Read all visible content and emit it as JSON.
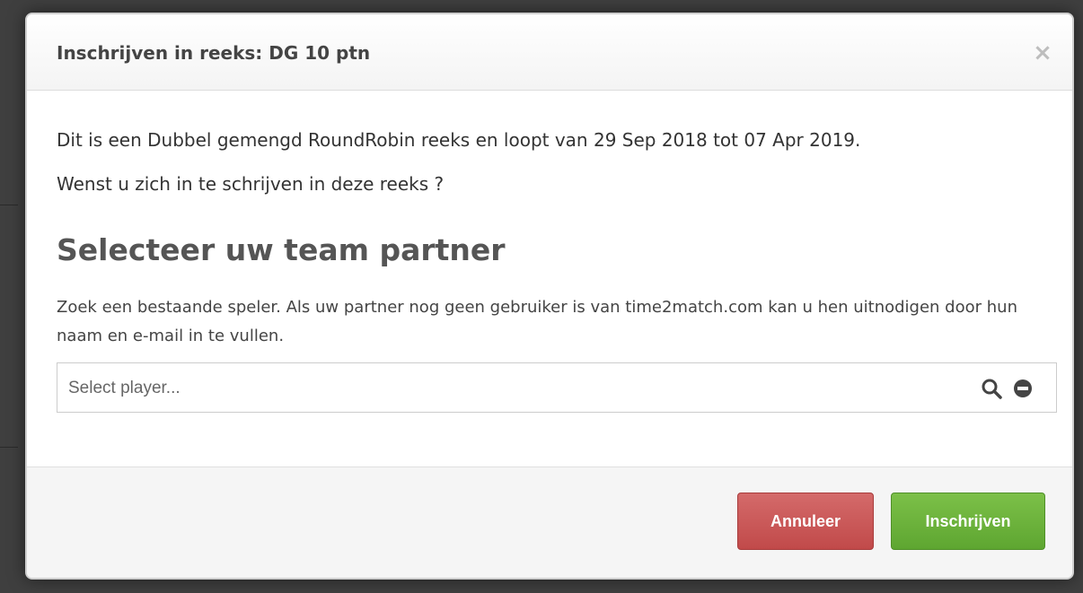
{
  "modal": {
    "title": "Inschrijven in reeks: DG 10 ptn",
    "close_symbol": "×",
    "close_icon": "close-icon",
    "description": "Dit is een Dubbel gemengd RoundRobin reeks en loopt van 29 Sep 2018 tot 07 Apr 2019.",
    "question": "Wenst u zich in te schrijven in deze reeks ?",
    "section_title": "Selecteer uw team partner",
    "help_text": "Zoek een bestaande speler. Als uw partner nog geen gebruiker is van time2match.com kan u hen uitnodigen door hun naam en e-mail in te vullen.",
    "player_select": {
      "placeholder": "Select player...",
      "value": "",
      "icons": [
        "search-icon",
        "minus-circle-icon"
      ]
    },
    "footer": {
      "cancel_label": "Annuleer",
      "submit_label": "Inschrijven"
    }
  },
  "colors": {
    "cancel_button": "#c9534f",
    "submit_button": "#6cb33f",
    "title_text": "#444444",
    "close_icon": "#bdbdbd"
  }
}
